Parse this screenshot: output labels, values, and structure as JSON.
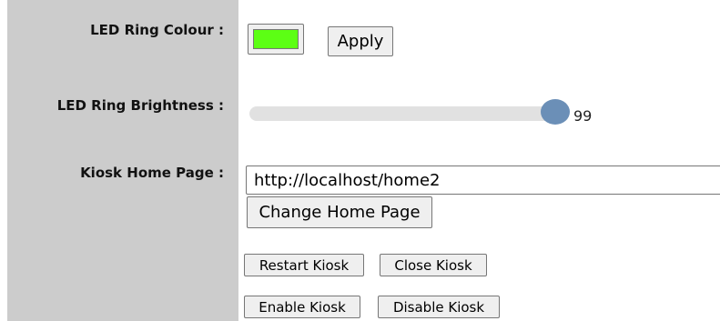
{
  "labels": {
    "led_colour": "LED Ring Colour :",
    "led_brightness": "LED Ring Brightness :",
    "kiosk_home": "Kiosk Home Page :"
  },
  "led_colour": {
    "value": "#5cff14",
    "apply_label": "Apply"
  },
  "brightness": {
    "value": "99",
    "max": 100
  },
  "home_page": {
    "url": "http://localhost/home2",
    "change_label": "Change Home Page"
  },
  "kiosk_buttons": {
    "restart": "Restart Kiosk",
    "close": "Close Kiosk",
    "enable": "Enable Kiosk",
    "disable": "Disable Kiosk"
  }
}
